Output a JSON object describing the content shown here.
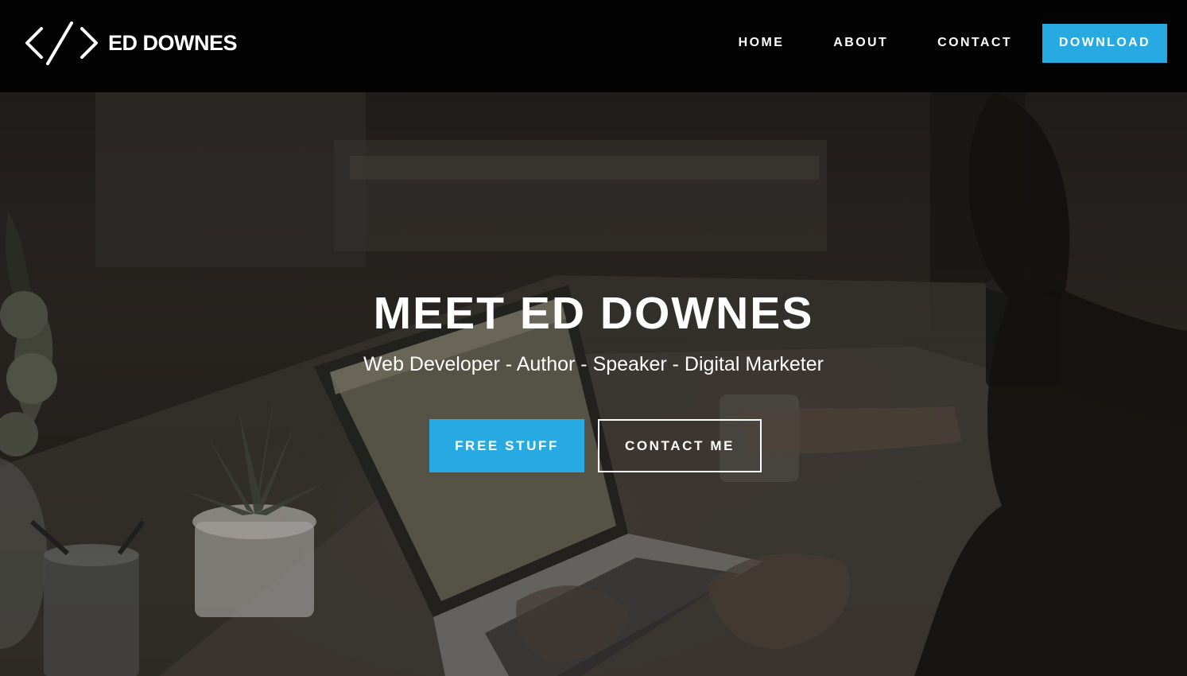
{
  "brand": {
    "name": "ED DOWNES",
    "icon": "code-brackets-icon"
  },
  "nav": {
    "links": [
      "HOME",
      "ABOUT",
      "CONTACT"
    ],
    "download_label": "DOWNLOAD"
  },
  "hero": {
    "title": "MEET ED DOWNES",
    "subtitle": "Web Developer - Author - Speaker - Digital Marketer",
    "primary_button": "FREE STUFF",
    "secondary_button": "CONTACT ME"
  },
  "colors": {
    "accent": "#27a9e1",
    "navbar_bg": "#030303",
    "text": "#ffffff"
  }
}
